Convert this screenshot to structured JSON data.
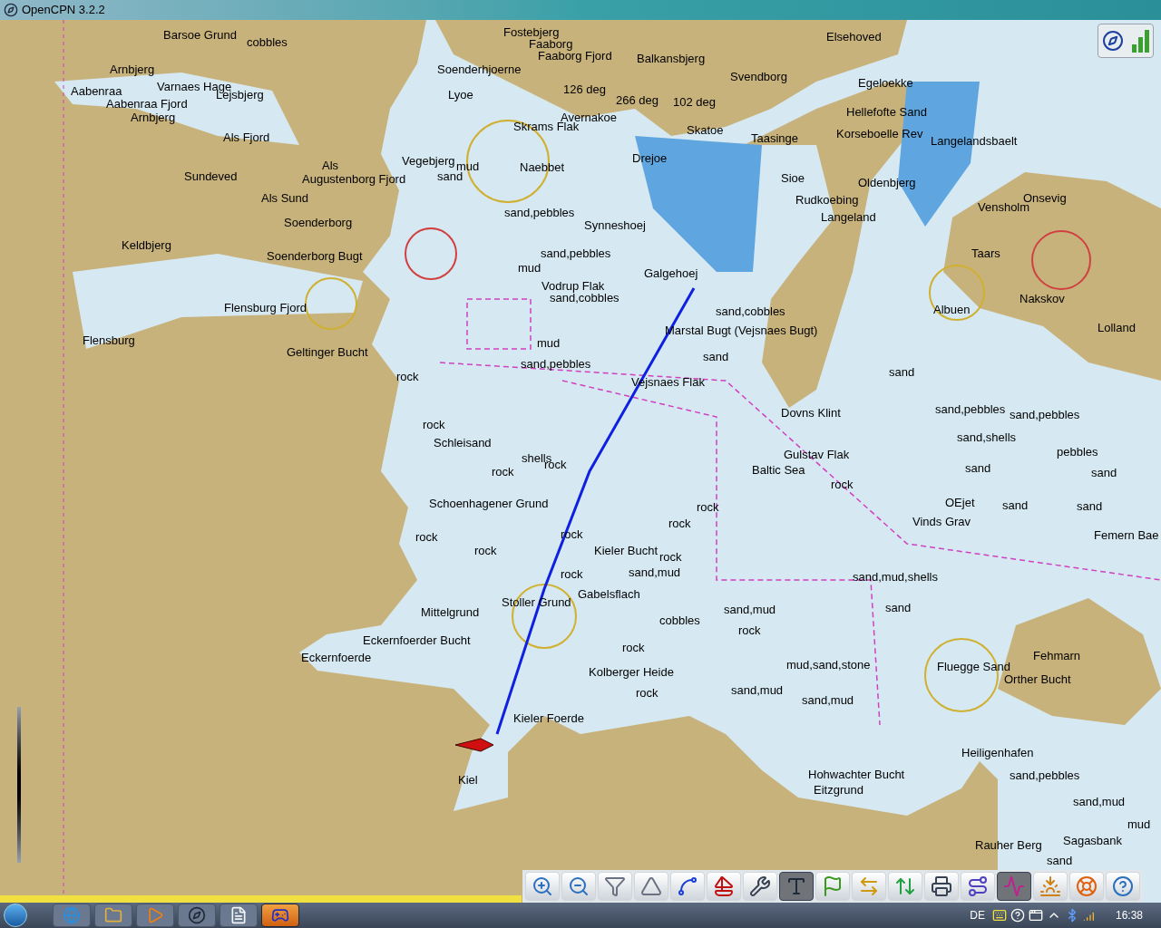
{
  "window": {
    "title": "OpenCPN 3.2.2"
  },
  "chart": {
    "labels": [
      {
        "text": "Barsoe Grund"
      },
      {
        "text": "cobbles"
      },
      {
        "text": "Fostebjerg"
      },
      {
        "text": "Faaborg"
      },
      {
        "text": "Faaborg Fjord"
      },
      {
        "text": "Balkansbjerg"
      },
      {
        "text": "Elsehoved"
      },
      {
        "text": "Svendborg"
      },
      {
        "text": "Arnbjerg"
      },
      {
        "text": "Aabenraa"
      },
      {
        "text": "Aabenraa Fjord"
      },
      {
        "text": "Arnbjerg"
      },
      {
        "text": "Varnaes Hage"
      },
      {
        "text": "Lejsbjerg"
      },
      {
        "text": "Soenderhjoerne"
      },
      {
        "text": "Lyoe"
      },
      {
        "text": "126 deg"
      },
      {
        "text": "266 deg"
      },
      {
        "text": "102 deg"
      },
      {
        "text": "Egeloekke"
      },
      {
        "text": "Hellefofte Sand"
      },
      {
        "text": "Avernakoe"
      },
      {
        "text": "Skrams Flak"
      },
      {
        "text": "Skatoe"
      },
      {
        "text": "Taasinge"
      },
      {
        "text": "Korseboelle Rev"
      },
      {
        "text": "Als Fjord"
      },
      {
        "text": "Langelandsbaelt"
      },
      {
        "text": "Vegebjerg"
      },
      {
        "text": "mud"
      },
      {
        "text": "sand"
      },
      {
        "text": "Naebbet"
      },
      {
        "text": "Drejoe"
      },
      {
        "text": "Sundeved"
      },
      {
        "text": "Augustenborg Fjord"
      },
      {
        "text": "Als"
      },
      {
        "text": "Sioe"
      },
      {
        "text": "Oldenbjerg"
      },
      {
        "text": "Onsevig"
      },
      {
        "text": "Vensholm"
      },
      {
        "text": "Als Sund"
      },
      {
        "text": "Rudkoebing"
      },
      {
        "text": "Langeland"
      },
      {
        "text": "Soenderborg"
      },
      {
        "text": "sand,pebbles"
      },
      {
        "text": "Synneshoej"
      },
      {
        "text": "Keldbjerg"
      },
      {
        "text": "Soenderborg Bugt"
      },
      {
        "text": "sand,pebbles"
      },
      {
        "text": "Taars"
      },
      {
        "text": "mud"
      },
      {
        "text": "Galgehoej"
      },
      {
        "text": "Vodrup Flak"
      },
      {
        "text": "sand,cobbles"
      },
      {
        "text": "Flensburg Fjord"
      },
      {
        "text": "Flensburg"
      },
      {
        "text": "Geltinger Bucht"
      },
      {
        "text": "sand,cobbles"
      },
      {
        "text": "Marstal Bugt (Vejsnaes Bugt)"
      },
      {
        "text": "Lolland"
      },
      {
        "text": "Nakskov"
      },
      {
        "text": "Albuen"
      },
      {
        "text": "mud"
      },
      {
        "text": "sand"
      },
      {
        "text": "sand,pebbles"
      },
      {
        "text": "rock"
      },
      {
        "text": "Vejsnaes Flak"
      },
      {
        "text": "sand"
      },
      {
        "text": "Dovns Klint"
      },
      {
        "text": "sand,pebbles"
      },
      {
        "text": "sand,pebbles"
      },
      {
        "text": "sand,shells"
      },
      {
        "text": "pebbles"
      },
      {
        "text": "rock"
      },
      {
        "text": "Schleisand"
      },
      {
        "text": "shells"
      },
      {
        "text": "rock"
      },
      {
        "text": "rock"
      },
      {
        "text": "Gulstav Flak"
      },
      {
        "text": "Baltic Sea"
      },
      {
        "text": "rock"
      },
      {
        "text": "sand"
      },
      {
        "text": "sand"
      },
      {
        "text": "Schoenhagener Grund"
      },
      {
        "text": "rock"
      },
      {
        "text": "OEjet"
      },
      {
        "text": "sand"
      },
      {
        "text": "sand"
      },
      {
        "text": "rock"
      },
      {
        "text": "rock"
      },
      {
        "text": "rock"
      },
      {
        "text": "Vinds Grav"
      },
      {
        "text": "rock"
      },
      {
        "text": "Kieler Bucht"
      },
      {
        "text": "rock"
      },
      {
        "text": "Femern Bae"
      },
      {
        "text": "rock"
      },
      {
        "text": "sand,mud"
      },
      {
        "text": "sand,mud,shells"
      },
      {
        "text": "Gabelsflach"
      },
      {
        "text": "Stoller Grund"
      },
      {
        "text": "Mittelgrund"
      },
      {
        "text": "sand,mud"
      },
      {
        "text": "sand"
      },
      {
        "text": "cobbles"
      },
      {
        "text": "rock"
      },
      {
        "text": "Eckernfoerder Bucht"
      },
      {
        "text": "rock"
      },
      {
        "text": "Fehmarn"
      },
      {
        "text": "Kolberger Heide"
      },
      {
        "text": "Fluegge Sand"
      },
      {
        "text": "Orther Bucht"
      },
      {
        "text": "mud,sand,stone"
      },
      {
        "text": "sand,mud"
      },
      {
        "text": "Eckernfoerde"
      },
      {
        "text": "rock"
      },
      {
        "text": "sand,mud"
      },
      {
        "text": "Kieler Foerde"
      },
      {
        "text": "Heiligenhafen"
      },
      {
        "text": "Hohwachter Bucht"
      },
      {
        "text": "sand,pebbles"
      },
      {
        "text": "Eitzgrund"
      },
      {
        "text": "Kiel"
      },
      {
        "text": "sand,mud"
      },
      {
        "text": "mud"
      },
      {
        "text": "Sagasbank"
      },
      {
        "text": "Rauher Berg"
      },
      {
        "text": "sand"
      }
    ]
  },
  "toolbar": [
    {
      "kind": "zoom_in",
      "selected": false
    },
    {
      "kind": "zoom_out",
      "selected": false
    },
    {
      "kind": "scale_in",
      "selected": false
    },
    {
      "kind": "scale_out",
      "selected": false
    },
    {
      "kind": "route",
      "selected": false
    },
    {
      "kind": "ownship",
      "selected": false
    },
    {
      "kind": "settings",
      "selected": false
    },
    {
      "kind": "text",
      "selected": true
    },
    {
      "kind": "marks",
      "selected": false
    },
    {
      "kind": "tides",
      "selected": false
    },
    {
      "kind": "currents",
      "selected": false
    },
    {
      "kind": "print",
      "selected": false
    },
    {
      "kind": "route_manager",
      "selected": false
    },
    {
      "kind": "track",
      "selected": true
    },
    {
      "kind": "sunset",
      "selected": false
    },
    {
      "kind": "mob",
      "selected": false
    },
    {
      "kind": "help",
      "selected": false
    }
  ],
  "taskbar": {
    "apps": [
      {
        "kind": "browser",
        "selected": false
      },
      {
        "kind": "explorer",
        "selected": false
      },
      {
        "kind": "media",
        "selected": false
      },
      {
        "kind": "opencpn",
        "selected": false
      },
      {
        "kind": "document",
        "selected": false
      },
      {
        "kind": "game",
        "selected": true
      }
    ],
    "language": "DE",
    "clock": "16:38"
  }
}
